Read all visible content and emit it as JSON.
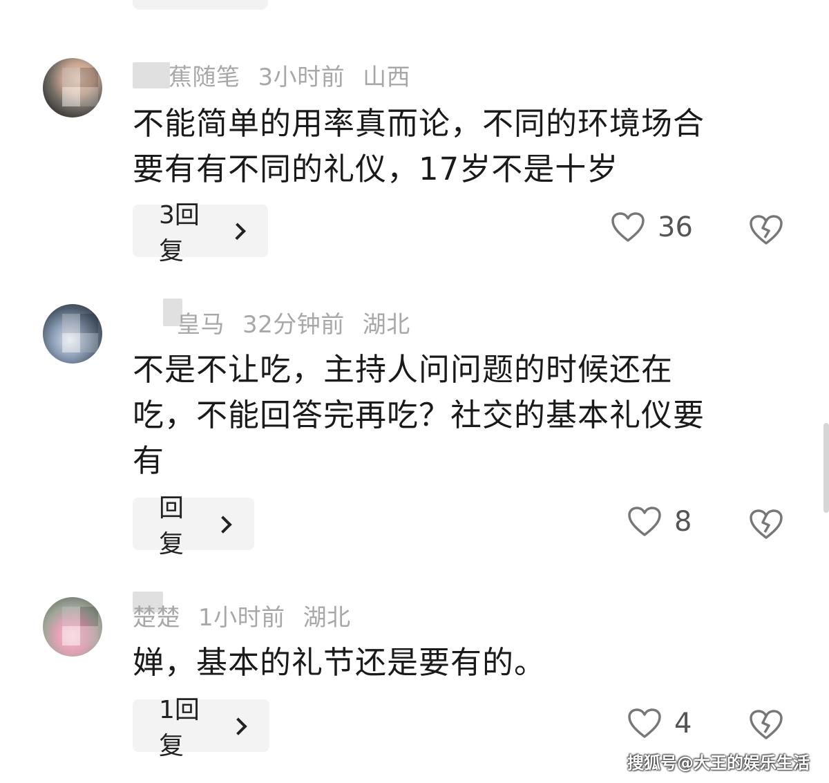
{
  "comments": [
    {
      "name": "蕉随笔",
      "time": "3小时前",
      "region": "山西",
      "text_lines": [
        "不能简单的用率真而论，不同的环境场合",
        "要有有不同的礼仪，17岁不是十岁"
      ],
      "reply_label": "3回复",
      "likes": "36"
    },
    {
      "name": "皇马",
      "time": "32分钟前",
      "region": "湖北",
      "text_lines": [
        "不是不让吃，主持人问问题的时候还在",
        "吃，不能回答完再吃？社交的基本礼仪要",
        "有"
      ],
      "reply_label": "回复",
      "likes": "8"
    },
    {
      "name": "楚楚",
      "time": "1小时前",
      "region": "湖北",
      "text_lines": [
        "婵，基本的礼节还是要有的。"
      ],
      "reply_label": "1回复",
      "likes": "4"
    }
  ],
  "icons": {
    "like": "heart-outline-icon",
    "dislike": "broken-heart-icon",
    "chevron": "chevron-right-icon"
  },
  "colors": {
    "meta_text": "#a8a8a8",
    "body_text": "#1a1a1a",
    "reply_bg": "#f3f3f3"
  },
  "watermark": "搜狐号@大王的娱乐生活"
}
